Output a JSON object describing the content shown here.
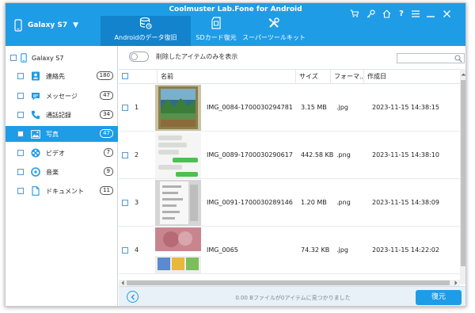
{
  "app": {
    "title": "Coolmuster Lab.Fone for Android"
  },
  "device": {
    "name": "Galaxy S7"
  },
  "tabs": [
    {
      "label": "Androidのデータ復旧",
      "icon": "database-icon"
    },
    {
      "label": "SDカード復元",
      "icon": "sd-card-icon"
    },
    {
      "label": "スーパーツールキット",
      "icon": "tools-icon"
    }
  ],
  "window_controls": [
    "cart-icon",
    "key-icon",
    "home-icon",
    "help-icon",
    "menu-icon",
    "minimize-icon",
    "close-icon"
  ],
  "sidebar": {
    "root_label": "Galaxy S7",
    "items": [
      {
        "label": "連絡先",
        "count": "180",
        "icon": "contacts-icon",
        "active": false
      },
      {
        "label": "メッセージ",
        "count": "47",
        "icon": "message-icon",
        "active": false
      },
      {
        "label": "通話記録",
        "count": "34",
        "icon": "phone-icon",
        "active": false
      },
      {
        "label": "写真",
        "count": "47",
        "icon": "photo-icon",
        "active": true
      },
      {
        "label": "ビデオ",
        "count": "7",
        "icon": "video-icon",
        "active": false
      },
      {
        "label": "音楽",
        "count": "9",
        "icon": "music-icon",
        "active": false
      },
      {
        "label": "ドキュメント",
        "count": "11",
        "icon": "document-icon",
        "active": false
      }
    ]
  },
  "toolbar": {
    "toggle_label": "削除したアイテムのみを表示",
    "search_placeholder": ""
  },
  "table": {
    "headers": {
      "name": "名前",
      "size": "サイズ",
      "format": "フォーマ...",
      "created": "作成日"
    },
    "rows": [
      {
        "num": "1",
        "filename": "IMG_0084-1700030294781",
        "size": "3.15 MB",
        "format": ".jpg",
        "date": "2023-11-15 14:38:15"
      },
      {
        "num": "2",
        "filename": "IMG_0089-1700030290617",
        "size": "442.58 KB",
        "format": ".png",
        "date": "2023-11-15 14:38:10"
      },
      {
        "num": "3",
        "filename": "IMG_0091-1700030289146",
        "size": "1.20 MB",
        "format": ".png",
        "date": "2023-11-15 14:38:09"
      },
      {
        "num": "4",
        "filename": "IMG_0065",
        "size": "74.32 KB",
        "format": ".jpg",
        "date": "2023-11-15 14:22:02"
      }
    ]
  },
  "footer": {
    "status": "0.00 Bファイルが0アイテムに見つかりました",
    "recover_label": "復元"
  },
  "colors": {
    "accent": "#1f9ce6",
    "active_tab": "#1283cc"
  }
}
